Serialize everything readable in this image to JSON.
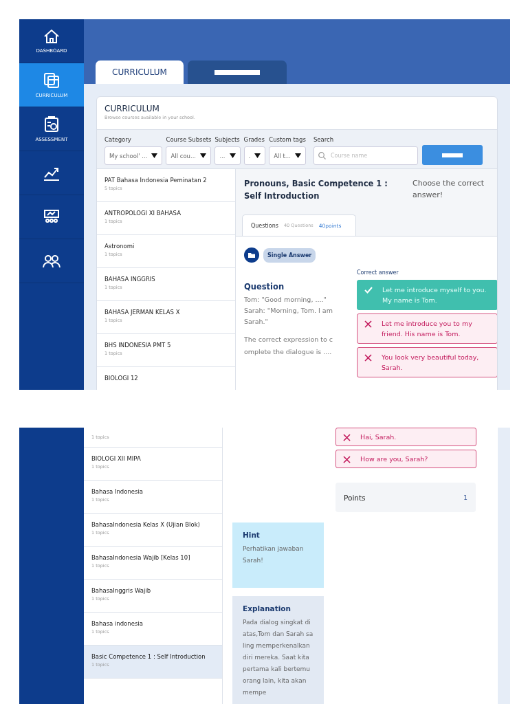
{
  "sidebar": {
    "items": [
      {
        "kind": "home",
        "label": "DASHBOARD",
        "selected": false
      },
      {
        "kind": "book",
        "label": "CURRICULUM",
        "selected": true
      },
      {
        "kind": "clipboard",
        "label": "ASSESSMENT",
        "selected": false
      },
      {
        "kind": "chart",
        "selected": false
      },
      {
        "kind": "board",
        "selected": false
      },
      {
        "kind": "people",
        "selected": false
      }
    ]
  },
  "tabs": [
    {
      "label": "CURRICULUM",
      "selected": true
    },
    {
      "selected": false
    }
  ],
  "curriculum": {
    "title": "CURRICULUM",
    "subtitle": "Browse courses available in your school."
  },
  "filters": [
    {
      "label": "Category",
      "value": "My school' ..."
    },
    {
      "label": "Course Subsets",
      "value": "All cou..."
    },
    {
      "label": "Subjects",
      "value": "..."
    },
    {
      "label": "Grades",
      "value": "."
    },
    {
      "label": "Custom tags",
      "value": "All t..."
    }
  ],
  "search": {
    "label": "Search",
    "placeholder": "Course name"
  },
  "courses": [
    {
      "title": "PAT Bahasa Indonesia Peminatan 2",
      "topics": "5 topics",
      "selected": false
    },
    {
      "title": "ANTROPOLOGI XI BAHASA",
      "topics": "1 topics",
      "selected": false
    },
    {
      "title": "Astronomi",
      "topics": "1 topics",
      "selected": false
    },
    {
      "title": "BAHASA INGGRIS",
      "topics": "1 topics",
      "selected": false
    },
    {
      "title": "BAHASA JERMAN KELAS X",
      "topics": "1 topics",
      "selected": false
    },
    {
      "title": "BHS INDONESIA PMT 5",
      "topics": "1 topics",
      "selected": false
    },
    {
      "title": "BIOLOGI 12",
      "selected": false
    }
  ],
  "question": {
    "title": "Pronouns, Basic Competence 1 : Self Introduction",
    "instruction": "Choose the correct answer!",
    "tab": {
      "label": "Questions",
      "count": "40 Questions",
      "points": "40points"
    },
    "type": "Single Answer",
    "heading": "Question",
    "dialogue": "Tom: \"Good morning, ....\" Sarah: \"Morning, Tom. I am Sarah.\"",
    "prompt": "The correct expression to complete the dialogue is ....",
    "answers_label": "Correct answer",
    "answers": [
      {
        "text": "Let me introduce myself to you. My name is Tom.",
        "correct": true
      },
      {
        "text": "Let me introduce you to my friend. His name is Tom.",
        "correct": false
      },
      {
        "text": "You look very beautiful today, Sarah.",
        "correct": false
      }
    ]
  },
  "courses_continued": [
    {
      "topics": "1 topics",
      "selected": false
    },
    {
      "title": "BIOLOGI XII MIPA",
      "topics": "1 topics",
      "selected": false
    },
    {
      "title": "Bahasa Indonesia",
      "topics": "1 topics",
      "selected": false
    },
    {
      "title": "BahasaIndonesia Kelas X (Ujian Blok)",
      "topics": "1 topics",
      "selected": false
    },
    {
      "title": "BahasaIndonesia Wajib [Kelas 10]",
      "topics": "1 topics",
      "selected": false
    },
    {
      "title": "BahasaInggris Wajib",
      "topics": "1 topics",
      "selected": false
    },
    {
      "title": "Bahasa indonesia",
      "topics": "1 topics",
      "selected": false
    },
    {
      "title": "Basic Competence 1 : Self Introduction",
      "topics": "1 topics",
      "selected": true
    }
  ],
  "answers_continued": [
    {
      "text": "Hai, Sarah.",
      "correct": false
    },
    {
      "text": "How are you, Sarah?",
      "correct": false
    }
  ],
  "points": {
    "label": "Points",
    "value": "1"
  },
  "hint": {
    "title": "Hint",
    "text": "Perhatikan jawaban Sarah!"
  },
  "explanation": {
    "title": "Explanation",
    "text": "Pada dialog singkat di atas,Tom dan Sarah saling memperkenalkan diri mereka. Saat kita pertama kali bertemu orang lain, kita akan mempe"
  }
}
